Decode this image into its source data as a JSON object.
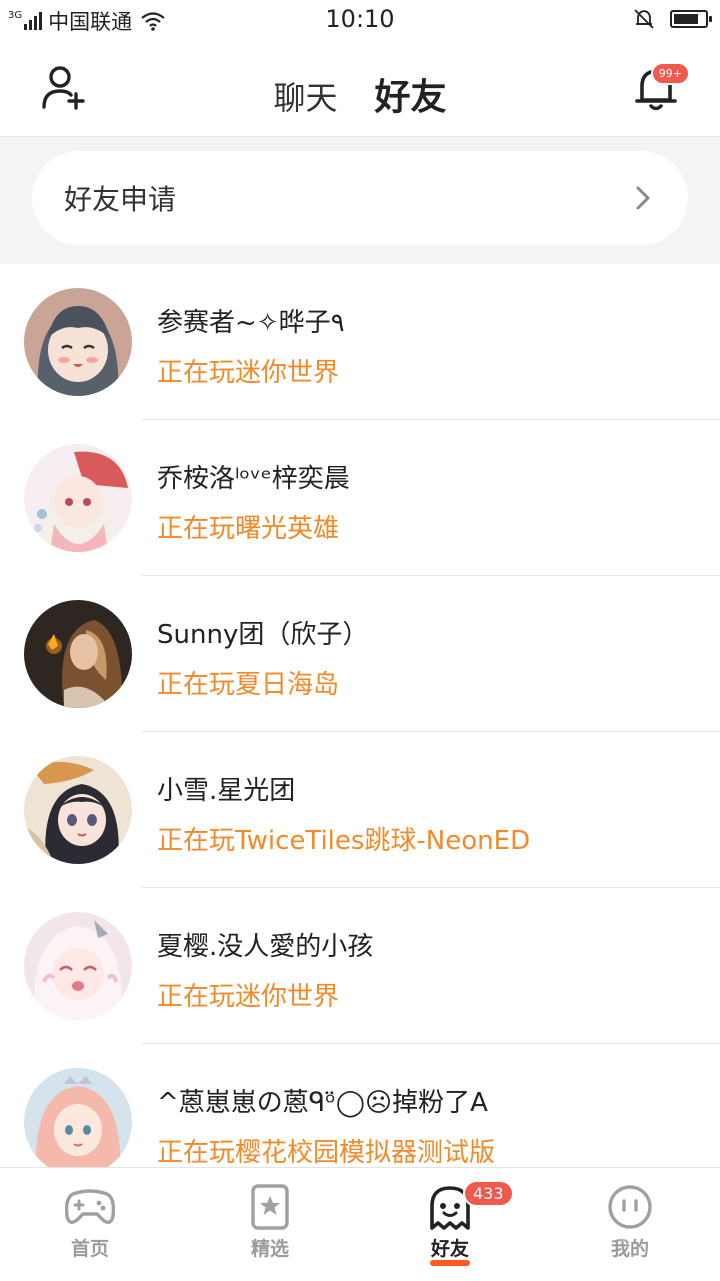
{
  "status_bar": {
    "network": "3G",
    "carrier": "中国联通",
    "time": "10:10"
  },
  "header": {
    "tabs": [
      {
        "label": "聊天",
        "active": false
      },
      {
        "label": "好友",
        "active": true
      }
    ],
    "notification_badge": "99+",
    "accent_color": "#ff5a1f"
  },
  "friend_request": {
    "label": "好友申请"
  },
  "friends": [
    {
      "name": "参赛者~✧晔子٩",
      "status": "正在玩迷你世界",
      "avatar_icon": "anime-girl-avatar"
    },
    {
      "name": "乔桉洛ˡᵒᵛᵉ梓奕晨",
      "status": "正在玩曙光英雄",
      "avatar_icon": "anime-girl-umbrella-avatar"
    },
    {
      "name": "Sunny团（欣子）",
      "status": "正在玩夏日海岛",
      "avatar_icon": "girl-with-butterfly-avatar"
    },
    {
      "name": "小雪.星光团",
      "status": "正在玩TwiceTiles跳球-NeonED",
      "avatar_icon": "anime-girl-cat-avatar"
    },
    {
      "name": "夏樱.没人愛的小孩",
      "status": "正在玩迷你世界",
      "avatar_icon": "anime-girl-pink-avatar"
    },
    {
      "name": "^蒽崽崽の蒽ᑫᵒ̈◯☹掉粉了A",
      "status": "正在玩樱花校园模拟器测试版",
      "avatar_icon": "anime-girl-tiara-avatar"
    }
  ],
  "status_color": "#f28a2a",
  "tab_bar": {
    "items": [
      {
        "label": "首页",
        "icon": "gamepad-icon",
        "active": false
      },
      {
        "label": "精选",
        "icon": "star-card-icon",
        "active": false
      },
      {
        "label": "好友",
        "icon": "ghost-icon",
        "active": true,
        "badge": "433"
      },
      {
        "label": "我的",
        "icon": "face-icon",
        "active": false
      }
    ]
  }
}
